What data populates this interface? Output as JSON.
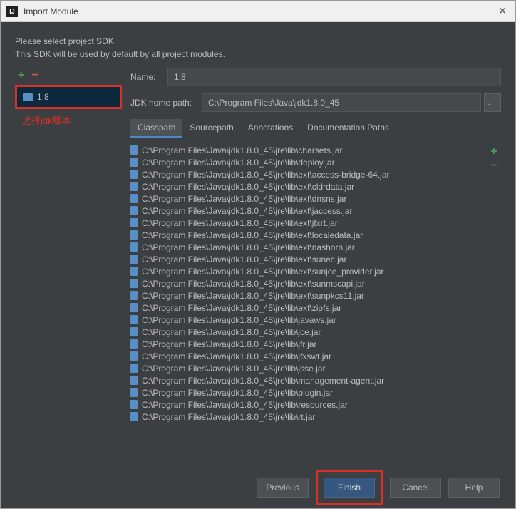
{
  "window": {
    "title": "Import Module",
    "icon_label": "IJ"
  },
  "intro": {
    "line1": "Please select project SDK.",
    "line2": "This SDK will be used by default by all project modules."
  },
  "sidebar": {
    "add_symbol": "+",
    "remove_symbol": "−",
    "selected_sdk": "1.8",
    "annotation": "选择jdk版本"
  },
  "fields": {
    "name_label": "Name:",
    "name_value": "1.8",
    "jdk_home_label": "JDK home path:",
    "jdk_home_value": "C:\\Program Files\\Java\\jdk1.8.0_45",
    "browse_label": "..."
  },
  "tabs": [
    {
      "label": "Classpath",
      "active": true
    },
    {
      "label": "Sourcepath",
      "active": false
    },
    {
      "label": "Annotations",
      "active": false
    },
    {
      "label": "Documentation Paths",
      "active": false
    }
  ],
  "jar_list": [
    "C:\\Program Files\\Java\\jdk1.8.0_45\\jre\\lib\\charsets.jar",
    "C:\\Program Files\\Java\\jdk1.8.0_45\\jre\\lib\\deploy.jar",
    "C:\\Program Files\\Java\\jdk1.8.0_45\\jre\\lib\\ext\\access-bridge-64.jar",
    "C:\\Program Files\\Java\\jdk1.8.0_45\\jre\\lib\\ext\\cldrdata.jar",
    "C:\\Program Files\\Java\\jdk1.8.0_45\\jre\\lib\\ext\\dnsns.jar",
    "C:\\Program Files\\Java\\jdk1.8.0_45\\jre\\lib\\ext\\jaccess.jar",
    "C:\\Program Files\\Java\\jdk1.8.0_45\\jre\\lib\\ext\\jfxrt.jar",
    "C:\\Program Files\\Java\\jdk1.8.0_45\\jre\\lib\\ext\\localedata.jar",
    "C:\\Program Files\\Java\\jdk1.8.0_45\\jre\\lib\\ext\\nashorn.jar",
    "C:\\Program Files\\Java\\jdk1.8.0_45\\jre\\lib\\ext\\sunec.jar",
    "C:\\Program Files\\Java\\jdk1.8.0_45\\jre\\lib\\ext\\sunjce_provider.jar",
    "C:\\Program Files\\Java\\jdk1.8.0_45\\jre\\lib\\ext\\sunmscapi.jar",
    "C:\\Program Files\\Java\\jdk1.8.0_45\\jre\\lib\\ext\\sunpkcs11.jar",
    "C:\\Program Files\\Java\\jdk1.8.0_45\\jre\\lib\\ext\\zipfs.jar",
    "C:\\Program Files\\Java\\jdk1.8.0_45\\jre\\lib\\javaws.jar",
    "C:\\Program Files\\Java\\jdk1.8.0_45\\jre\\lib\\jce.jar",
    "C:\\Program Files\\Java\\jdk1.8.0_45\\jre\\lib\\jfr.jar",
    "C:\\Program Files\\Java\\jdk1.8.0_45\\jre\\lib\\jfxswt.jar",
    "C:\\Program Files\\Java\\jdk1.8.0_45\\jre\\lib\\jsse.jar",
    "C:\\Program Files\\Java\\jdk1.8.0_45\\jre\\lib\\management-agent.jar",
    "C:\\Program Files\\Java\\jdk1.8.0_45\\jre\\lib\\plugin.jar",
    "C:\\Program Files\\Java\\jdk1.8.0_45\\jre\\lib\\resources.jar",
    "C:\\Program Files\\Java\\jdk1.8.0_45\\jre\\lib\\rt.jar"
  ],
  "side_controls": {
    "add": "+",
    "remove": "−"
  },
  "footer": {
    "previous": "Previous",
    "finish": "Finish",
    "cancel": "Cancel",
    "help": "Help"
  }
}
